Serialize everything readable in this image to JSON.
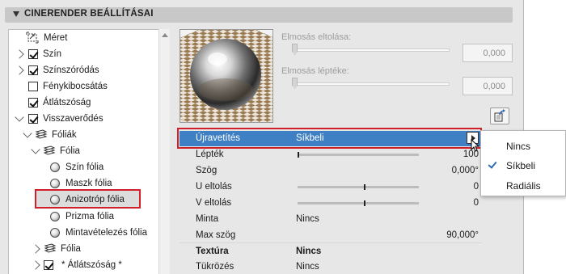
{
  "section": {
    "title": "CINERENDER BEÁLLÍTÁSAI"
  },
  "tree": [
    {
      "label": "Méret",
      "icon": "size-icon"
    },
    {
      "label": "Szín",
      "checked": true
    },
    {
      "label": "Színszóródás",
      "checked": true
    },
    {
      "label": "Fénykibocsátás",
      "checked": false
    },
    {
      "label": "Átlátszóság",
      "checked": true
    },
    {
      "label": "Visszaverődés",
      "checked": true
    },
    {
      "label": "Fóliák",
      "icon": "layers-icon"
    },
    {
      "label": "Fólia",
      "icon": "layers-icon"
    },
    {
      "label": "Szín fólia",
      "icon": "shader-ball-icon"
    },
    {
      "label": "Maszk fólia",
      "icon": "shader-ball-icon"
    },
    {
      "label": "Anizotróp fólia",
      "icon": "shader-ball-icon",
      "selected": true
    },
    {
      "label": "Prizma fólia",
      "icon": "shader-ball-icon"
    },
    {
      "label": "Mintavételezés fólia",
      "icon": "shader-ball-icon"
    },
    {
      "label": "Fólia",
      "icon": "layers-icon"
    },
    {
      "label": "* Átlátszóság *",
      "checked": true
    }
  ],
  "blur": {
    "offset_label": "Elmosás eltolása:",
    "offset_value": "0,000",
    "offset_level": 0,
    "scale_label": "Elmosás léptéke:",
    "scale_value": "0,000",
    "scale_level": 0
  },
  "properties": [
    {
      "key": "Újravetítés",
      "value": "Síkbeli",
      "selected": true
    },
    {
      "key": "Lépték",
      "value": "100",
      "slider": 0.0
    },
    {
      "key": "Szög",
      "value": "0,000°"
    },
    {
      "key": "U eltolás",
      "value": "0",
      "slider": 0.55
    },
    {
      "key": "V eltolás",
      "value": "0",
      "slider": 0.55
    },
    {
      "key": "Minta",
      "value": "Nincs"
    },
    {
      "key": "Max szög",
      "value": "90,000°"
    },
    {
      "key": "Textúra",
      "value": "Nincs",
      "bold": true
    },
    {
      "key": "Tükrözés",
      "value": "Nincs"
    }
  ],
  "menu": {
    "items": [
      "Nincs",
      "Síkbeli",
      "Radiális"
    ],
    "checked_index": 1
  },
  "colors": {
    "selection": "#3f7fc3",
    "highlight_outline": "#d2202a",
    "check": "#2f6bb5"
  }
}
